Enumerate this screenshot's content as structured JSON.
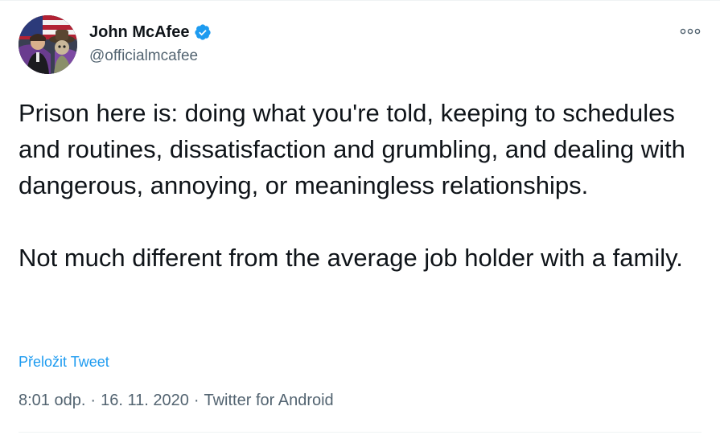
{
  "author": {
    "display_name": "John McAfee",
    "handle": "@officialmcafee",
    "verified": true
  },
  "tweet": {
    "paragraphs": [
      "Prison here is: doing what you're told, keeping to schedules and routines, dissatisfaction and grumbling, and dealing with dangerous, annoying, or meaningless relationships.",
      "Not much different from the average job holder with a family."
    ],
    "translate_link": "Přeložit Tweet",
    "time": "8:01 odp.",
    "date": "16. 11. 2020",
    "source": "Twitter for Android",
    "separator": "·"
  },
  "icons": {
    "more": "more-horizontal-icon",
    "verified": "verified-badge-icon"
  },
  "colors": {
    "verified_blue": "#1d9bf0",
    "link_blue": "#1d9bf0",
    "secondary_text": "#536471",
    "primary_text": "#0f1419"
  }
}
